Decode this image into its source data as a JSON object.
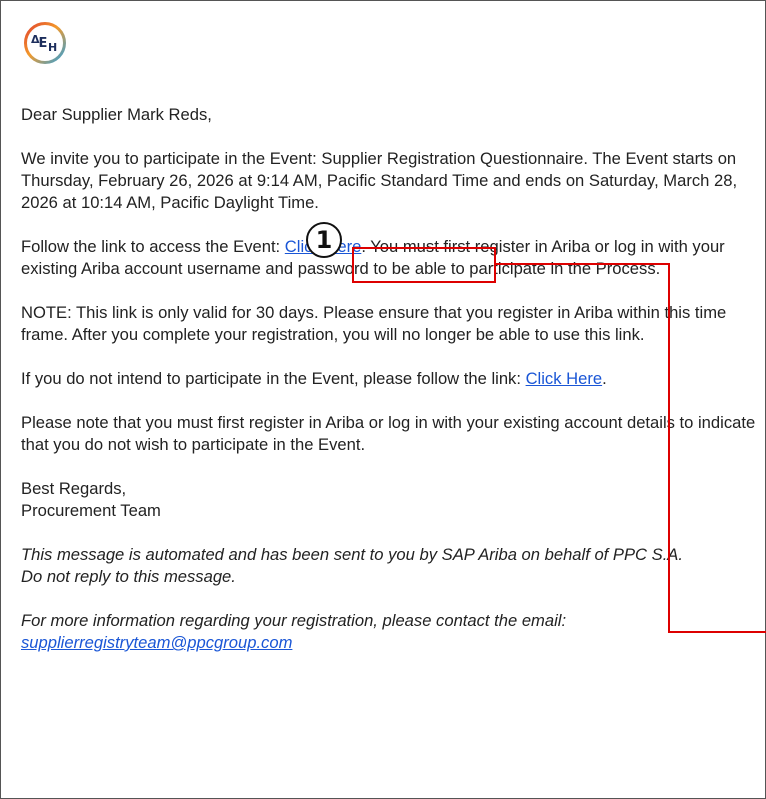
{
  "logo": {
    "text_delta": "Δ",
    "text_e": "E",
    "text_h": "H",
    "ring_colors": [
      "#e0412d",
      "#f39a2b",
      "#2ea0dc"
    ]
  },
  "email": {
    "greeting": "Dear Supplier Mark Reds,",
    "invite_paragraph": "We invite you to participate in the Event: Supplier Registration Questionnaire. The Event starts on Thursday, February 26, 2026 at 9:14 AM, Pacific Standard Time and ends on Saturday, March 28, 2026 at 10:14 AM, Pacific Daylight Time.",
    "follow_prefix": "Follow the link to access the Event: ",
    "follow_link": "Click Here",
    "follow_suffix": ". You must first register in Ariba or log in with your existing Ariba account username and password to be able to participate in the Process.",
    "note_paragraph": "NOTE: This link is only valid for 30 days. Please ensure that you register in Ariba within this time frame. After you complete your registration, you will no longer be able to use this link.",
    "decline_prefix": "If you do not intend to participate in the Event, please follow the link: ",
    "decline_link": "Click Here",
    "decline_suffix": ".",
    "decline_note": "Please note that you must first register in Ariba or log in with your existing account details to indicate that you do not wish to participate in the Event.",
    "closing": "Best Regards,",
    "signature": "Procurement Team",
    "automated_line1": "This message is automated and has been sent to you by SAP Ariba on behalf of PPC S.A.",
    "automated_line2": "Do not reply to this message.",
    "contact_line": "For more information regarding your registration, please contact the email:",
    "contact_email": "supplierregistryteam@ppcgroup.com"
  },
  "annotation": {
    "badge_number": "1",
    "color": "#dd0000"
  }
}
